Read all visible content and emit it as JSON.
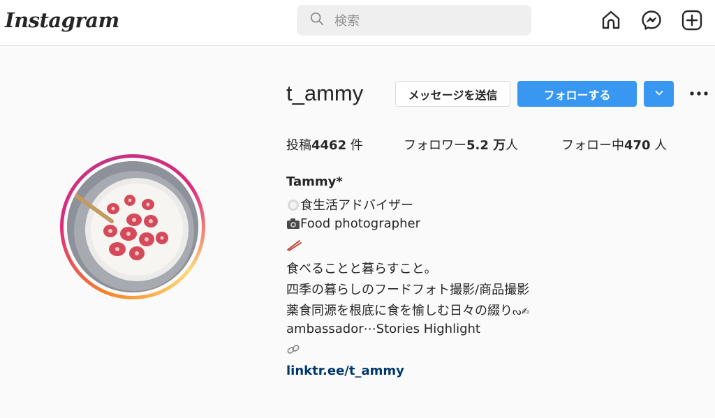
{
  "header": {
    "logo": "Instagram",
    "search_placeholder": "検索",
    "icons": [
      "search-icon",
      "home-icon",
      "messenger-icon",
      "new-post-icon"
    ]
  },
  "profile": {
    "username": "t_ammy",
    "message_button": "メッセージを送信",
    "follow_button": "フォローする",
    "stats": {
      "posts_prefix": "投稿",
      "posts_count": "4462",
      "posts_suffix": " 件",
      "followers_prefix": "フォロワー",
      "followers_count": "5.2 万",
      "followers_suffix": "人",
      "following_prefix": "フォロー中",
      "following_count": "470",
      "following_suffix": " 人"
    },
    "bio": {
      "name": "Tammy*",
      "line1": "食生活アドバイザー",
      "line2": "Food photographer",
      "line3": "食べることと暮らすこと。",
      "line4": "四季の暮らしのフードフォト撮影/商品撮影",
      "line5": "薬食同源を根底に食を愉しむ日々の綴り",
      "line5_icons": "ᔓ✍",
      "line6": "ambassador⋯Stories Highlight",
      "link": "linktr.ee/t_ammy"
    }
  },
  "colors": {
    "accent": "#3897f0",
    "link": "#00376b",
    "background": "#fafafa"
  }
}
